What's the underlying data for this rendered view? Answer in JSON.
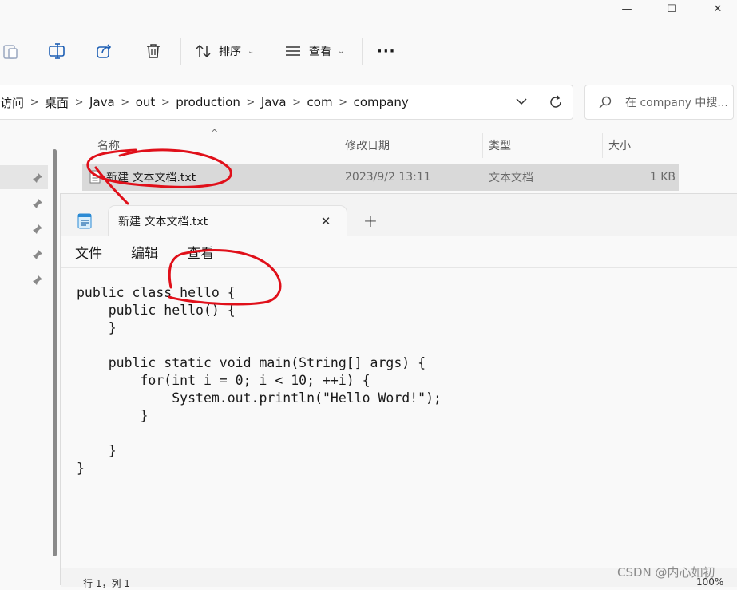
{
  "explorer": {
    "window_controls": [
      "—",
      "☐",
      "✕"
    ],
    "toolbar": {
      "sort_label": "排序",
      "view_label": "查看",
      "more_label": "···"
    },
    "breadcrumb": {
      "items": [
        "访问",
        "桌面",
        "Java",
        "out",
        "production",
        "Java",
        "com",
        "company"
      ]
    },
    "search": {
      "placeholder": "在 company 中搜..."
    },
    "columns": {
      "name": "名称",
      "modified": "修改日期",
      "type": "类型",
      "size": "大小"
    },
    "files": [
      {
        "name": "新建 文本文档.txt",
        "modified": "2023/9/2 13:11",
        "type": "文本文档",
        "size": "1 KB"
      }
    ]
  },
  "notepad": {
    "tab_title": "新建 文本文档.txt",
    "close_glyph": "✕",
    "new_tab_glyph": "+",
    "menu": {
      "file": "文件",
      "edit": "编辑",
      "view": "查看"
    },
    "content": "public class hello {\n    public hello() {\n    }\n\n    public static void main(String[] args) {\n        for(int i = 0; i < 10; ++i) {\n            System.out.println(\"Hello Word!\");\n        }\n\n    }\n}",
    "status": {
      "position": "行 1，列 1",
      "zoom": "100%"
    }
  },
  "watermark": "CSDN @内心如初",
  "colors": {
    "annotation": "#e0101a",
    "selection": "#d9d9d9"
  }
}
